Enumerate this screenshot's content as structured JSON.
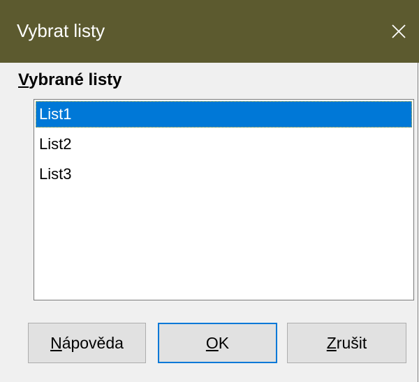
{
  "window": {
    "title": "Vybrat listy"
  },
  "section": {
    "label_mnemonic": "V",
    "label_rest": "ybrané listy"
  },
  "sheets": [
    {
      "name": "List1",
      "selected": true
    },
    {
      "name": "List2",
      "selected": false
    },
    {
      "name": "List3",
      "selected": false
    }
  ],
  "buttons": {
    "help": {
      "mnemonic": "N",
      "rest": "ápověda"
    },
    "ok": {
      "mnemonic": "O",
      "rest": "K"
    },
    "cancel": {
      "mnemonic": "Z",
      "rest": "rušit"
    }
  },
  "colors": {
    "titlebar": "#5c5a2f",
    "selection": "#0078d7",
    "default_button_border": "#0078d7"
  },
  "icons": {
    "close": "close-icon"
  }
}
